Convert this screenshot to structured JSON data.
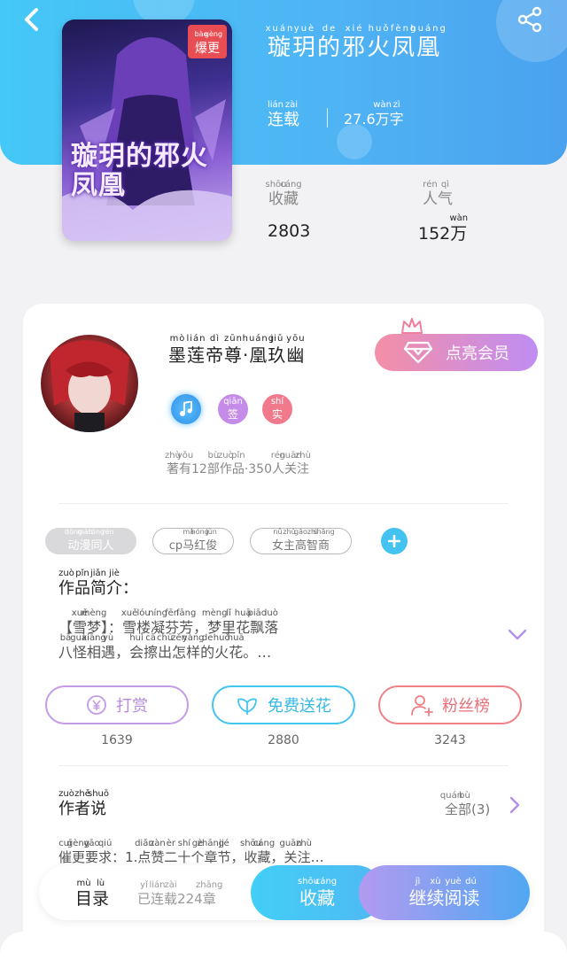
{
  "book": {
    "title": [
      [
        "xuán",
        "璇"
      ],
      [
        "yuè",
        "玥"
      ],
      [
        "de",
        "的"
      ],
      [
        "xié",
        "邪"
      ],
      [
        "huǒ",
        "火"
      ],
      [
        "fèng",
        "凤"
      ],
      [
        "huáng",
        "凰"
      ]
    ],
    "status": [
      [
        "lián",
        "连"
      ],
      [
        "zài",
        "载"
      ]
    ],
    "word_count": [
      [
        "",
        "27.6"
      ],
      [
        "wàn",
        "万"
      ],
      [
        "zì",
        "字"
      ]
    ],
    "cover_badge": [
      [
        "bào",
        "爆"
      ],
      [
        "gèng",
        "更"
      ]
    ],
    "cover_title": "璇玥的邪火凤凰",
    "stats": {
      "favorites_label": [
        [
          "shōu",
          "收"
        ],
        [
          "cáng",
          "藏"
        ]
      ],
      "favorites_value": "2803",
      "popularity_label": [
        [
          "rén",
          "人"
        ],
        [
          "qì",
          "气"
        ]
      ],
      "popularity_value": [
        [
          "",
          "152"
        ],
        [
          "wàn",
          "万"
        ]
      ]
    }
  },
  "author": {
    "name": [
      [
        "mò",
        "墨"
      ],
      [
        "lián",
        "莲"
      ],
      [
        "dì",
        "帝"
      ],
      [
        "zūn",
        "尊"
      ],
      [
        "",
        "·"
      ],
      [
        "huáng",
        "凰"
      ],
      [
        "jiǔ",
        "玖"
      ],
      [
        "yōu",
        "幽"
      ]
    ],
    "vip_button": "点亮会员",
    "level_badges": [
      {
        "icon": "music-note-icon",
        "color": "#3aa7f5"
      },
      {
        "label": [
          [
            "qiān",
            "签"
          ]
        ],
        "color": "#c48be8"
      },
      {
        "label": [
          [
            "shí",
            "实"
          ]
        ],
        "color": "#f07a8c"
      }
    ],
    "summary": [
      [
        "zhù",
        "著"
      ],
      [
        "yǒu",
        "有"
      ],
      [
        "",
        "12"
      ],
      [
        "bù",
        "部"
      ],
      [
        "zuò",
        "作"
      ],
      [
        "pǐn",
        "品"
      ],
      [
        "",
        "·350"
      ],
      [
        "rén",
        "人"
      ],
      [
        "guān",
        "关"
      ],
      [
        "zhù",
        "注"
      ]
    ]
  },
  "tags": [
    {
      "label": [
        [
          "dòng",
          "动"
        ],
        [
          "màn",
          "漫"
        ],
        [
          "tóng",
          "同"
        ],
        [
          "rén",
          "人"
        ]
      ],
      "style": "filled"
    },
    {
      "label": [
        [
          "",
          "cp"
        ],
        [
          "mǎ",
          "马"
        ],
        [
          "hóng",
          "红"
        ],
        [
          "jùn",
          "俊"
        ]
      ],
      "style": "outline"
    },
    {
      "label": [
        [
          "nǚ",
          "女"
        ],
        [
          "zhǔ",
          "主"
        ],
        [
          "gāo",
          "高"
        ],
        [
          "zhì",
          "智"
        ],
        [
          "shāng",
          "商"
        ]
      ],
      "style": "outline"
    }
  ],
  "intro": {
    "heading": [
      [
        "zuò",
        "作"
      ],
      [
        "pǐn",
        "品"
      ],
      [
        "jiǎn",
        "简"
      ],
      [
        "jiè",
        "介"
      ],
      [
        "",
        "："
      ]
    ],
    "line1": [
      [
        "",
        "【"
      ],
      [
        "xuě",
        "雪"
      ],
      [
        "mèng",
        "梦"
      ],
      [
        "",
        "】："
      ],
      [
        "xuě",
        "雪"
      ],
      [
        "lóu",
        "楼"
      ],
      [
        "níng",
        "凝"
      ],
      [
        "fēn",
        "芬"
      ],
      [
        "fāng",
        "芳"
      ],
      [
        "",
        "，"
      ],
      [
        "mèng",
        "梦"
      ],
      [
        "lǐ",
        "里"
      ],
      [
        "huā",
        "花"
      ],
      [
        "piāo",
        "飘"
      ],
      [
        "luò",
        "落"
      ]
    ],
    "line2": [
      [
        "bā",
        "八"
      ],
      [
        "guài",
        "怪"
      ],
      [
        "xiāng",
        "相"
      ],
      [
        "yù",
        "遇"
      ],
      [
        "",
        "，"
      ],
      [
        "huì",
        "会"
      ],
      [
        "cā",
        "擦"
      ],
      [
        "chū",
        "出"
      ],
      [
        "zěn",
        "怎"
      ],
      [
        "yàng",
        "样"
      ],
      [
        "de",
        "的"
      ],
      [
        "huǒ",
        "火"
      ],
      [
        "huā",
        "花"
      ],
      [
        "",
        "。…"
      ]
    ]
  },
  "actions": [
    {
      "label": "打赏",
      "count": "1639",
      "color": "#c39be6",
      "icon": "yen-icon"
    },
    {
      "label": "免费送花",
      "count": "2880",
      "color": "#43c6ee",
      "icon": "flower-icon"
    },
    {
      "label": "粉丝榜",
      "count": "3243",
      "color": "#f07f86",
      "icon": "user-rank-icon"
    }
  ],
  "author_says": {
    "heading": [
      [
        "zuò",
        "作"
      ],
      [
        "zhě",
        "者"
      ],
      [
        "shuō",
        "说"
      ]
    ],
    "all_label": [
      [
        "quán",
        "全"
      ],
      [
        "bù",
        "部"
      ],
      [
        "",
        "(3)"
      ]
    ],
    "message": [
      [
        "cuī",
        "催"
      ],
      [
        "gèng",
        "更"
      ],
      [
        "yāo",
        "要"
      ],
      [
        "qiú",
        "求"
      ],
      [
        "",
        "：1."
      ],
      [
        "diǎn",
        "点"
      ],
      [
        "zàn",
        "赞"
      ],
      [
        "èr",
        "二"
      ],
      [
        "shí",
        "十"
      ],
      [
        "gè",
        "个"
      ],
      [
        "zhāng",
        "章"
      ],
      [
        "jié",
        "节"
      ],
      [
        "",
        "，"
      ],
      [
        "shōu",
        "收"
      ],
      [
        "cáng",
        "藏"
      ],
      [
        "",
        "，"
      ],
      [
        "guān",
        "关"
      ],
      [
        "zhù",
        "注"
      ],
      [
        "",
        "…"
      ]
    ]
  },
  "bottom_bar": {
    "catalog": [
      [
        "mù",
        "目"
      ],
      [
        "lù",
        "录"
      ]
    ],
    "progress": [
      [
        "yǐ",
        "已"
      ],
      [
        "lián",
        "连"
      ],
      [
        "zài",
        "载"
      ],
      [
        "",
        "224"
      ],
      [
        "zhāng",
        "章"
      ]
    ],
    "favorite": [
      [
        "shōu",
        "收"
      ],
      [
        "cáng",
        "藏"
      ]
    ],
    "read": [
      [
        "jì",
        "继"
      ],
      [
        "xù",
        "续"
      ],
      [
        "yuè",
        "阅"
      ],
      [
        "dú",
        "读"
      ]
    ]
  }
}
